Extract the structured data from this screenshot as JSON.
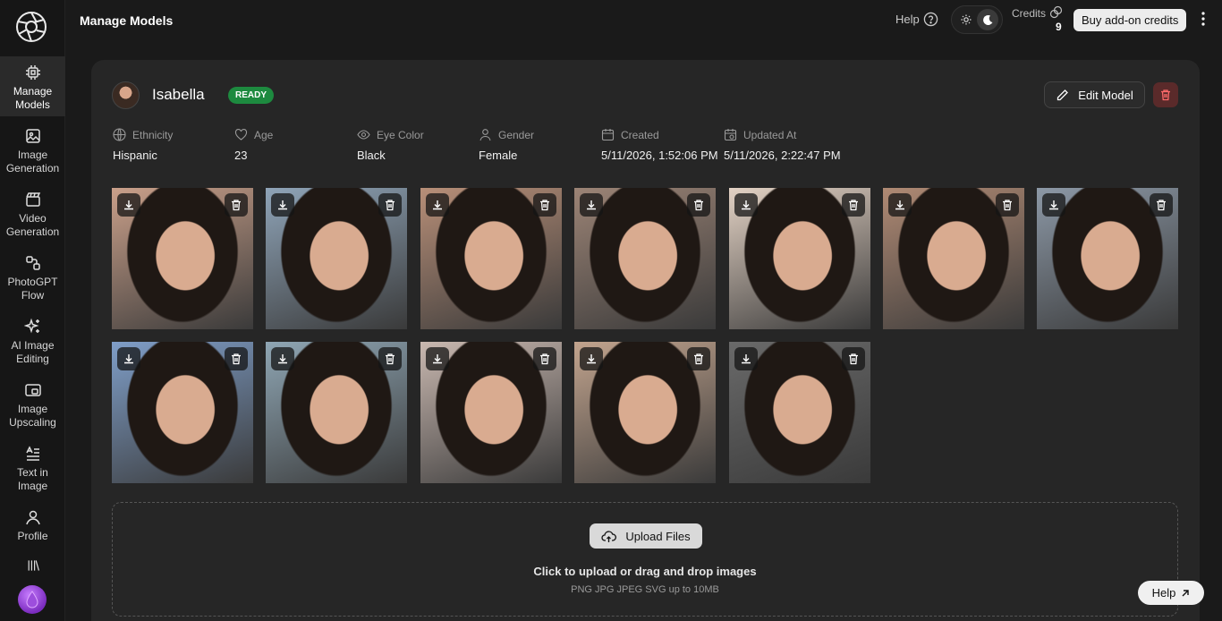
{
  "sidebar": {
    "items": [
      {
        "label": "Manage\nModels",
        "icon": "cpu-icon",
        "active": true
      },
      {
        "label": "Image\nGeneration",
        "icon": "image-icon"
      },
      {
        "label": "Video\nGeneration",
        "icon": "clapperboard-icon"
      },
      {
        "label": "PhotoGPT\nFlow",
        "icon": "flow-icon"
      },
      {
        "label": "AI Image\nEditing",
        "icon": "sparkles-icon"
      },
      {
        "label": "Image\nUpscaling",
        "icon": "upscale-icon"
      },
      {
        "label": "Text in\nImage",
        "icon": "text-icon"
      },
      {
        "label": "Profile",
        "icon": "user-icon"
      }
    ]
  },
  "header": {
    "title": "Manage Models",
    "help": "Help",
    "credits_label": "Credits",
    "credits_count": "9",
    "buy_label": "Buy add-on credits"
  },
  "model": {
    "name": "Isabella",
    "status": "READY",
    "edit_label": "Edit Model",
    "attributes": [
      {
        "label": "Ethnicity",
        "value": "Hispanic",
        "icon": "globe-icon"
      },
      {
        "label": "Age",
        "value": "23",
        "icon": "heart-icon"
      },
      {
        "label": "Eye Color",
        "value": "Black",
        "icon": "eye-icon"
      },
      {
        "label": "Gender",
        "value": "Female",
        "icon": "person-icon"
      },
      {
        "label": "Created",
        "value": "5/11/2026, 1:52:06 PM",
        "icon": "calendar-icon"
      },
      {
        "label": "Updated At",
        "value": "5/11/2026, 2:22:47 PM",
        "icon": "calendar-clock-icon"
      }
    ],
    "images": [
      {
        "tone": "#caa08a"
      },
      {
        "tone": "#8fa4b8"
      },
      {
        "tone": "#b88f78"
      },
      {
        "tone": "#9c8476"
      },
      {
        "tone": "#e3d2c4"
      },
      {
        "tone": "#b08a74"
      },
      {
        "tone": "#8c98a6"
      },
      {
        "tone": "#7f9ec8"
      },
      {
        "tone": "#8fa6b4"
      },
      {
        "tone": "#c9b8b0"
      },
      {
        "tone": "#c2a48e"
      },
      {
        "tone": "#6a6a6a"
      }
    ]
  },
  "upload": {
    "button": "Upload Files",
    "title": "Click to upload or drag and drop images",
    "subtitle": "PNG JPG JPEG SVG up to 10MB"
  },
  "help_fab": "Help"
}
